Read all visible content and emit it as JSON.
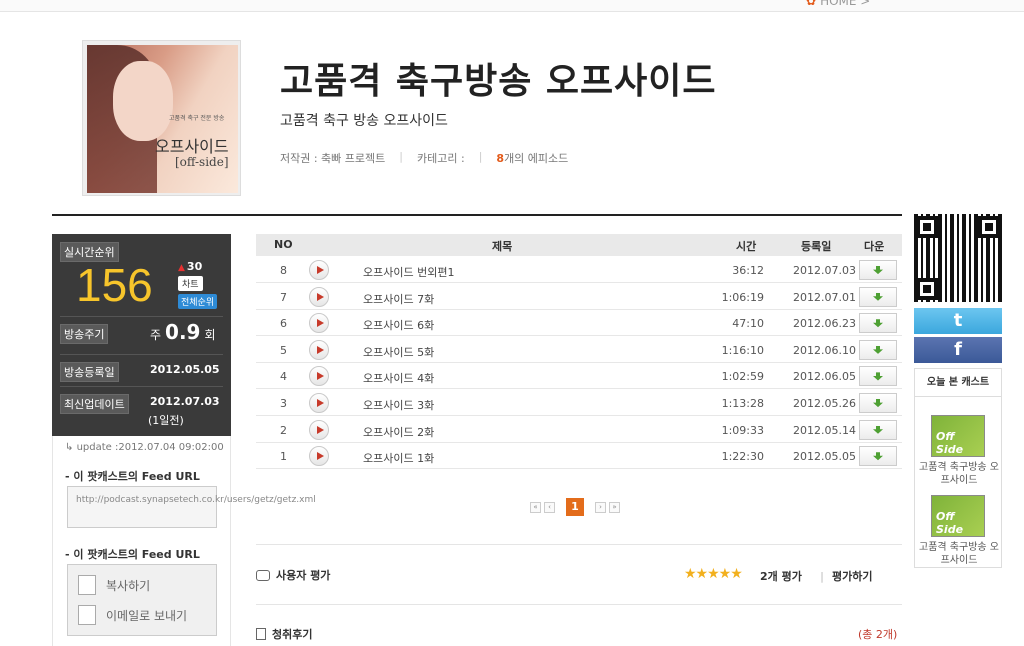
{
  "topbar": {
    "home_label": "HOME >"
  },
  "cover": {
    "line1": "고품격 축구 전문 방송",
    "line2": "오프사이드",
    "line3": "[off-side]"
  },
  "podcast": {
    "title": "고품격 축구방송 오프사이드",
    "subtitle": "고품격 축구 방송 오프사이드",
    "author_label": "저작권 : 축빠 프로젝트",
    "category_label": "카테고리 :",
    "episode_count": "8",
    "episode_suffix": "개의 에피소드"
  },
  "stats": {
    "realtime_rank_label": "실시간순위",
    "rank": "156",
    "rank_change": "30",
    "chart_label": "차트",
    "all_rank_label": "전체순위",
    "cycle_label": "방송주기",
    "cycle_prefix": "주",
    "cycle_value": "0.9",
    "cycle_suffix": "회",
    "registered_label": "방송등록일",
    "registered_date": "2012.05.05",
    "updated_label": "최신업데이트",
    "updated_date": "2012.07.03",
    "updated_ago": "(1일전)",
    "update_time": "update :2012.07.04 09:02:00"
  },
  "feed": {
    "title1": "- 이 팟캐스트의 Feed URL",
    "url": "http://podcast.synapsetech.co.kr/users/getz/getz.xml",
    "title2": "- 이 팟캐스트의 Feed URL",
    "copy_label": "복사하기",
    "email_label": "이메일로 보내기"
  },
  "table": {
    "headers": {
      "no": "NO",
      "title": "제목",
      "time": "시간",
      "date": "등록일",
      "download": "다운"
    },
    "rows": [
      {
        "no": "8",
        "title": "오프사이드 번외편1",
        "time": "36:12",
        "date": "2012.07.03"
      },
      {
        "no": "7",
        "title": "오프사이드 7화",
        "time": "1:06:19",
        "date": "2012.07.01"
      },
      {
        "no": "6",
        "title": "오프사이드 6화",
        "time": "47:10",
        "date": "2012.06.23"
      },
      {
        "no": "5",
        "title": "오프사이드 5화",
        "time": "1:16:10",
        "date": "2012.06.10"
      },
      {
        "no": "4",
        "title": "오프사이드 4화",
        "time": "1:02:59",
        "date": "2012.06.05"
      },
      {
        "no": "3",
        "title": "오프사이드 3화",
        "time": "1:13:28",
        "date": "2012.05.26"
      },
      {
        "no": "2",
        "title": "오프사이드 2화",
        "time": "1:09:33",
        "date": "2012.05.14"
      },
      {
        "no": "1",
        "title": "오프사이드 1화",
        "time": "1:22:30",
        "date": "2012.05.05"
      }
    ]
  },
  "pager": {
    "first": "«",
    "prev": "‹",
    "current": "1",
    "next": "›",
    "last": "»"
  },
  "reviews": {
    "title": "사용자 평가",
    "stars": "★★★★★",
    "count": "2개 평가",
    "rate_label": "평가하기",
    "listen_title": "청취후기",
    "total": "(총 2개)"
  },
  "sidebar": {
    "twitter": "t",
    "facebook": "f",
    "today_title": "오늘 본 캐스트",
    "thumb_text": "Off Side",
    "items": [
      {
        "title": "고품격 축구방송 오프사이드"
      },
      {
        "title": "고품격 축구방송 오프사이드"
      }
    ]
  },
  "colors": {
    "accent": "#e36c1b",
    "rank": "#f7c52b",
    "panel": "#3a3a3a",
    "twitter": "#3ba7dd",
    "facebook": "#3b5998"
  }
}
